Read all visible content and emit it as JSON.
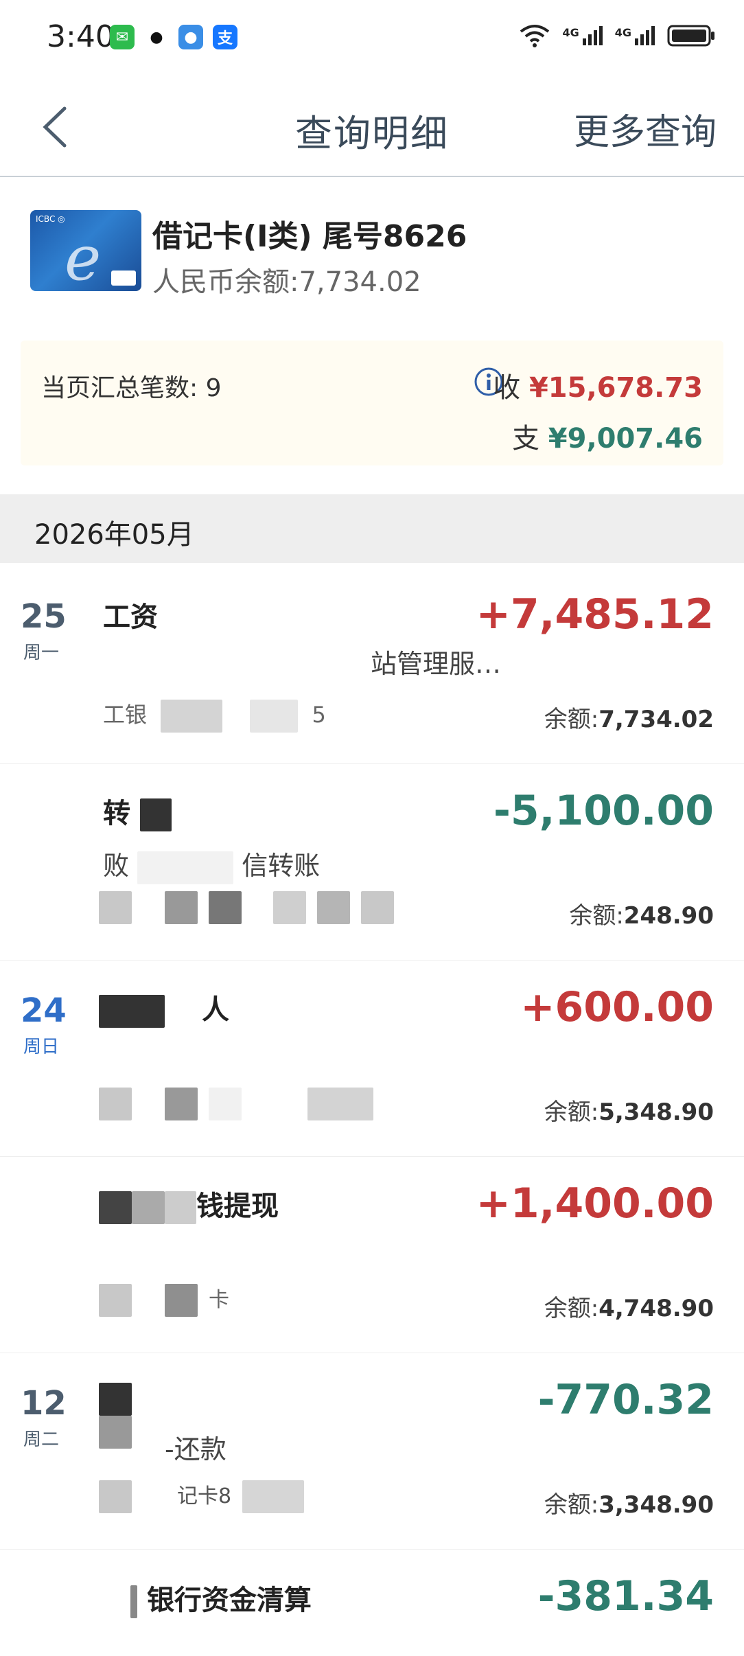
{
  "status_bar": {
    "time": "3:40",
    "signal1": "4G",
    "signal2": "4G"
  },
  "nav": {
    "title": "查询明细",
    "more": "更多查询"
  },
  "account": {
    "title": "借记卡(I类) 尾号8626",
    "balance": "人民币余额:7,734.02"
  },
  "summary": {
    "count_label": "当页汇总笔数: 9",
    "income_label": "收",
    "income_value": "¥15,678.73",
    "expense_label": "支",
    "expense_value": "¥9,007.46"
  },
  "month": "2026年05月",
  "transactions": [
    {
      "day": "25",
      "weekday": "周一",
      "title": "工资",
      "amount": "+7,485.12",
      "desc": "站管理服…",
      "sub": "工银",
      "sub2": "5",
      "balance_label": "余额:",
      "balance": "7,734.02"
    },
    {
      "day": "",
      "weekday": "",
      "title": "转",
      "amount": "-5,100.00",
      "desc": "信转账",
      "desc_prefix": "败",
      "sub": "",
      "balance_label": "余额:",
      "balance": "248.90"
    },
    {
      "day": "24",
      "weekday": "周日",
      "title": "人",
      "amount": "+600.00",
      "desc": "",
      "sub": "",
      "balance_label": "余额:",
      "balance": "5,348.90"
    },
    {
      "day": "",
      "weekday": "",
      "title": "钱提现",
      "amount": "+1,400.00",
      "desc": "",
      "sub": "卡",
      "balance_label": "余额:",
      "balance": "4,748.90"
    },
    {
      "day": "12",
      "weekday": "周二",
      "title": "",
      "amount": "-770.32",
      "desc": "-还款",
      "sub": "记卡8",
      "balance_label": "余额:",
      "balance": "3,348.90"
    },
    {
      "day": "",
      "weekday": "",
      "title": "银行资金清算",
      "amount": "-381.34",
      "desc": "",
      "sub": "",
      "balance_label": "",
      "balance": ""
    }
  ],
  "colors": {
    "income": "#c43a3a",
    "expense": "#2e7d6e",
    "date_blue": "#2f6ec8"
  }
}
